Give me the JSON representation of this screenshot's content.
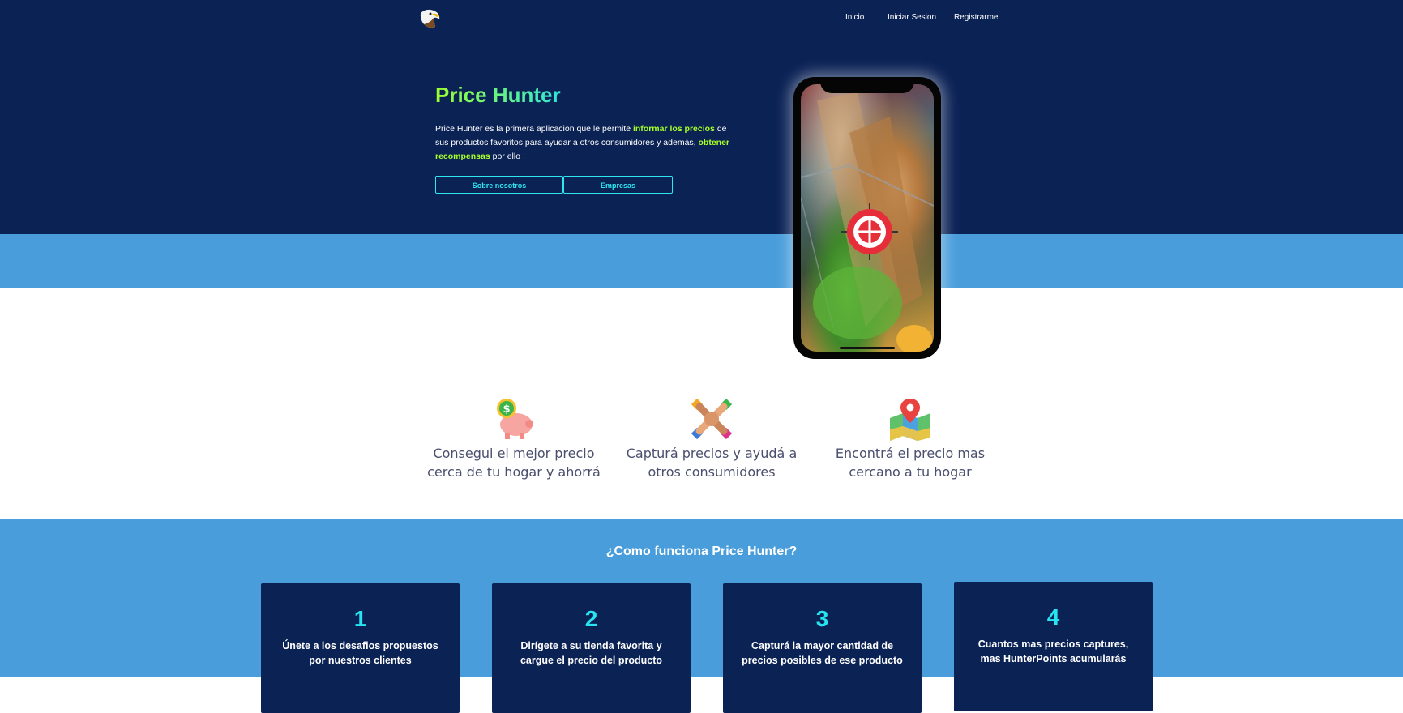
{
  "nav": {
    "links": [
      {
        "label": "Inicio"
      },
      {
        "label": "Iniciar Sesion"
      },
      {
        "label": "Registrarme"
      }
    ]
  },
  "hero": {
    "title": "Price Hunter",
    "description": {
      "part1": "Price Hunter es la primera aplicacion que le permite ",
      "highlight1": "informar los precios",
      "part2": " de sus productos favoritos para ayudar a otros consumidores y además, ",
      "highlight2": "obtener recompensas",
      "part3": " por ello !"
    },
    "buttons": [
      {
        "label": "Sobre nosotros"
      },
      {
        "label": "Empresas"
      }
    ]
  },
  "features": [
    {
      "icon": "piggy-bank-icon",
      "text": "Consegui el mejor precio cerca de tu hogar y ahorrá"
    },
    {
      "icon": "hands-together-icon",
      "text": "Capturá precios y ayudá a otros consumidores"
    },
    {
      "icon": "map-pin-icon",
      "text": "Encontrá el precio mas cercano a tu hogar"
    }
  ],
  "how_it_works": {
    "title": "¿Como funciona Price Hunter?",
    "steps": [
      {
        "number": "1",
        "text": "Únete a los desafios propuestos por nuestros clientes"
      },
      {
        "number": "2",
        "text": "Dirígete a su tienda favorita y cargue el precio del producto"
      },
      {
        "number": "3",
        "text": "Capturá la mayor cantidad de precios posibles de ese producto"
      },
      {
        "number": "4",
        "text": "Cuantos mas precios captures, mas HunterPoints acumularás"
      }
    ]
  },
  "colors": {
    "navy": "#0b2255",
    "light_blue": "#499ddb",
    "accent_green": "#a7ff2a",
    "accent_cyan": "#2fe6f0"
  }
}
